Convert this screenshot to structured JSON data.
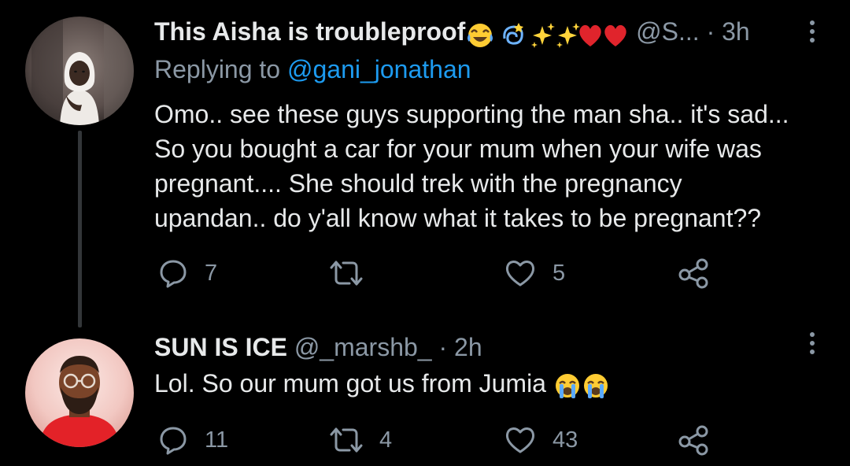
{
  "tweets": [
    {
      "display_name": "This Aisha is troubleproof",
      "name_emojis": [
        "face-with-tears-of-joy-icon",
        "dizzy-icon",
        "sparkles-icon",
        "sparkles-icon",
        "red-heart-icon",
        "red-heart-icon"
      ],
      "handle": "@S...",
      "separator": "·",
      "time": "3h",
      "replying_prefix": "Replying to",
      "replying_handle": "@gani_jonathan",
      "body_lines": [
        "Omo.. see these guys supporting the man sha.. it's sad...",
        "So you bought a car for your mum when your wife was",
        "pregnant.... She should trek with the pregnancy",
        "upandan.. do y'all know what it takes to be pregnant??"
      ],
      "reply_count": "7",
      "retweet_count": "",
      "like_count": "5"
    },
    {
      "display_name": "SUN IS ICE",
      "handle": "@_marshb_",
      "separator": "·",
      "time": "2h",
      "body_text": "Lol. So our mum got us from Jumia",
      "body_emojis": [
        "loudly-crying-face-icon",
        "loudly-crying-face-icon"
      ],
      "reply_count": "11",
      "retweet_count": "4",
      "like_count": "43"
    }
  ],
  "colors": {
    "background": "#000000",
    "primary_text": "#e7e9ea",
    "secondary_text": "#8b98a5",
    "link": "#1d9bf0",
    "thread_line": "#333639"
  }
}
